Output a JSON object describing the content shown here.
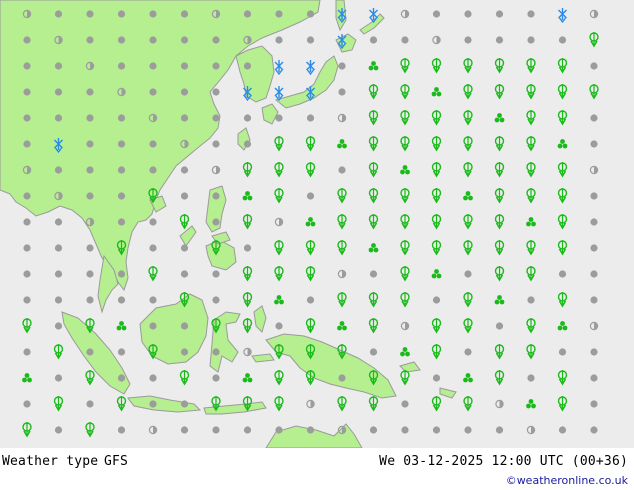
{
  "footer": {
    "title": "Weather type",
    "model": "GFS",
    "datetime": "We 03-12-2025 12:00 UTC (00+36)",
    "credit": "©weatheronline.co.uk"
  },
  "colors": {
    "sea": "#ececec",
    "land": "#b5ef90",
    "coast": "#9a9a9a",
    "dry": "#9c9c9c",
    "rain": "#1aba1a",
    "snow": "#2c8be6"
  },
  "icon_types": [
    "cloudy-dot-icon",
    "partly-cloudy-icon",
    "rain-drizzle-icon",
    "rain-icon",
    "snow-icon"
  ]
}
